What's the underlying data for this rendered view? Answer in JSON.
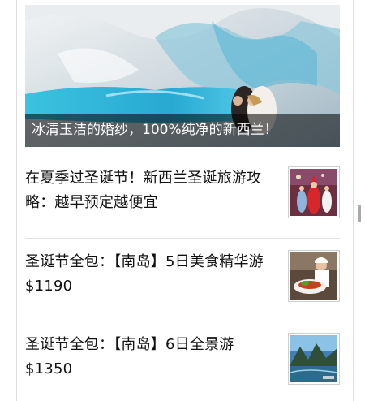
{
  "hero": {
    "caption": "冰清玉洁的婚纱，100%纯净的新西兰！"
  },
  "articles": [
    {
      "title": "在夏季过圣诞节！新西兰圣诞旅游攻略：越早预定越便宜"
    },
    {
      "title": "圣诞节全包：【南岛】5日美食精华游 $1190"
    },
    {
      "title": "圣诞节全包：【南岛】6日全景游 $1350"
    }
  ]
}
